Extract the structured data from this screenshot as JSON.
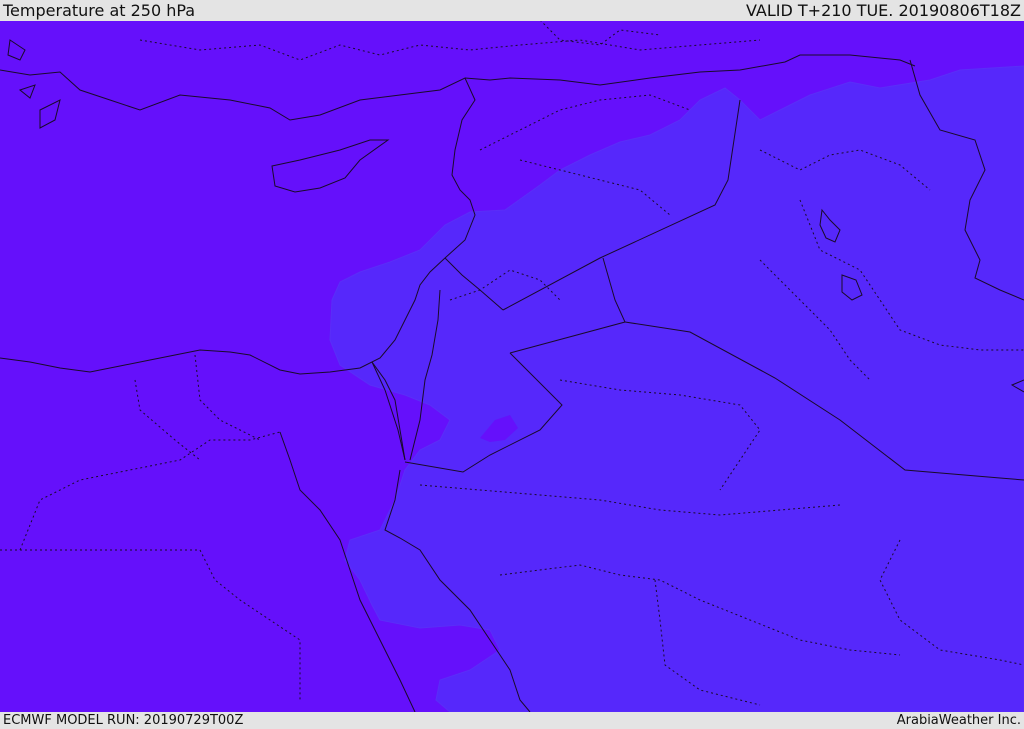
{
  "header": {
    "title": "Temperature at 250 hPa",
    "valid": "VALID T+210 TUE. 20190806T18Z"
  },
  "footer": {
    "model_run": "ECMWF MODEL RUN: 20190729T00Z",
    "credit": "ArabiaWeather Inc."
  },
  "map": {
    "colors": {
      "cold_fill": "#6510fb",
      "warm_fill": "#5628fb",
      "warm_edge": "#5a2ef8",
      "border_line": "#1a0a2a"
    }
  }
}
